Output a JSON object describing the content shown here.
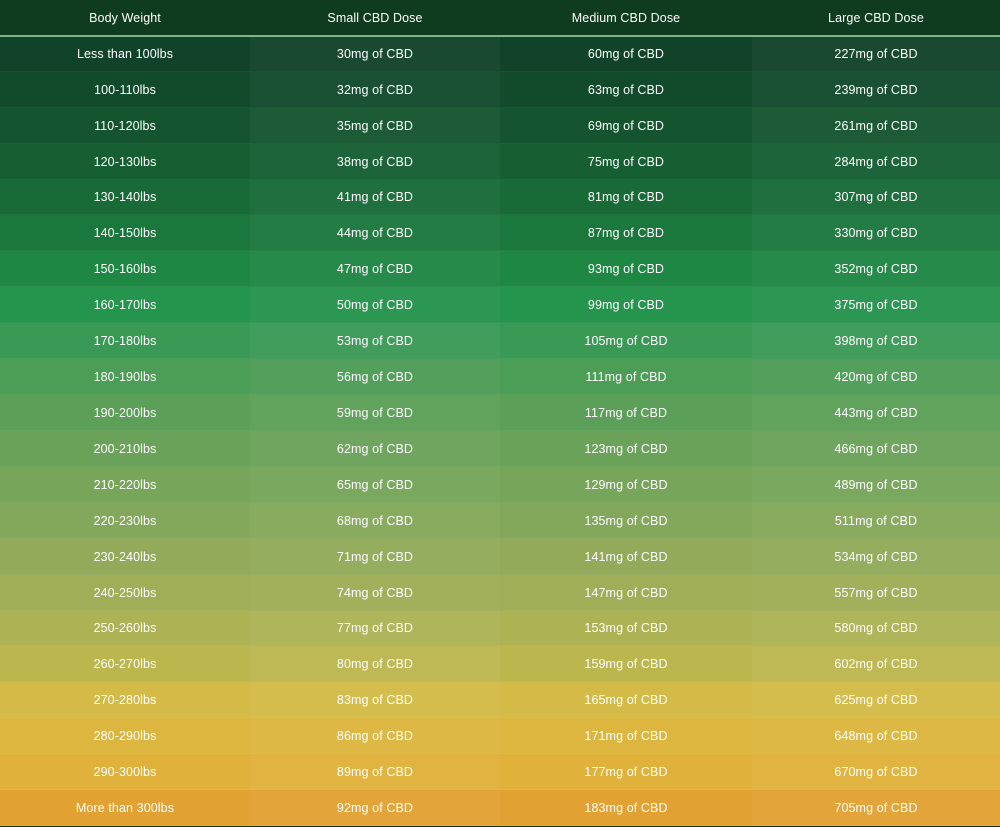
{
  "table": {
    "headers": [
      "Body Weight",
      "Small CBD Dose",
      "Medium CBD Dose",
      "Large CBD Dose"
    ],
    "rows": [
      [
        "Less than 100lbs",
        "30mg of CBD",
        "60mg of CBD",
        "227mg of CBD"
      ],
      [
        "100-110lbs",
        "32mg of CBD",
        "63mg of CBD",
        "239mg of CBD"
      ],
      [
        "110-120lbs",
        "35mg of CBD",
        "69mg of CBD",
        "261mg of CBD"
      ],
      [
        "120-130lbs",
        "38mg of CBD",
        "75mg of CBD",
        "284mg of CBD"
      ],
      [
        "130-140lbs",
        "41mg of CBD",
        "81mg of CBD",
        "307mg of CBD"
      ],
      [
        "140-150lbs",
        "44mg of CBD",
        "87mg of CBD",
        "330mg of CBD"
      ],
      [
        "150-160lbs",
        "47mg of CBD",
        "93mg of CBD",
        "352mg of CBD"
      ],
      [
        "160-170lbs",
        "50mg of CBD",
        "99mg of CBD",
        "375mg of CBD"
      ],
      [
        "170-180lbs",
        "53mg of CBD",
        "105mg of CBD",
        "398mg of CBD"
      ],
      [
        "180-190lbs",
        "56mg of CBD",
        "111mg of CBD",
        "420mg of CBD"
      ],
      [
        "190-200lbs",
        "59mg of CBD",
        "117mg of CBD",
        "443mg of CBD"
      ],
      [
        "200-210lbs",
        "62mg of CBD",
        "123mg of CBD",
        "466mg of CBD"
      ],
      [
        "210-220lbs",
        "65mg of CBD",
        "129mg of CBD",
        "489mg of CBD"
      ],
      [
        "220-230lbs",
        "68mg of CBD",
        "135mg of CBD",
        "511mg of CBD"
      ],
      [
        "230-240lbs",
        "71mg of CBD",
        "141mg of CBD",
        "534mg of CBD"
      ],
      [
        "240-250lbs",
        "74mg of CBD",
        "147mg of CBD",
        "557mg of CBD"
      ],
      [
        "250-260lbs",
        "77mg of CBD",
        "153mg of CBD",
        "580mg of CBD"
      ],
      [
        "260-270lbs",
        "80mg of CBD",
        "159mg of CBD",
        "602mg of CBD"
      ],
      [
        "270-280lbs",
        "83mg of CBD",
        "165mg of CBD",
        "625mg of CBD"
      ],
      [
        "280-290lbs",
        "86mg of CBD",
        "171mg of CBD",
        "648mg of CBD"
      ],
      [
        "290-300lbs",
        "89mg of CBD",
        "177mg of CBD",
        "670mg of CBD"
      ],
      [
        "More than 300lbs",
        "92mg of CBD",
        "183mg of CBD",
        "705mg of CBD"
      ]
    ],
    "row_colors": [
      "#11432a",
      "#124a2c",
      "#14552f",
      "#165f33",
      "#186a37",
      "#1b783d",
      "#1f8744",
      "#25944c",
      "#3a9a55",
      "#4c9d56",
      "#5c9f58",
      "#6aa259",
      "#77a55a",
      "#84a85b",
      "#92aa59",
      "#9fae57",
      "#adb354",
      "#bcb64f",
      "#d4bb47",
      "#dcb63f",
      "#e0b23b",
      "#e2a233"
    ]
  }
}
